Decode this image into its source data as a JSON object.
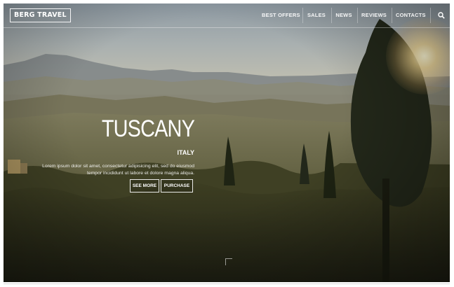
{
  "brand": {
    "logo_text": "BERG TRAVEL"
  },
  "nav": {
    "items": [
      {
        "label": "BEST OFFERS"
      },
      {
        "label": "SALES"
      },
      {
        "label": "NEWS"
      },
      {
        "label": "REVIEWS"
      },
      {
        "label": "CONTACTS"
      }
    ],
    "search_icon": "search-icon"
  },
  "hero": {
    "title": "TUSCANY",
    "subtitle": "ITALY",
    "description": "Lorem ipsum dolor sit amet, consectetur adipisicing elit, sed do eiusmod tempor incididunt ut labore et dolore magna aliqua.",
    "buttons": {
      "see_more": "SEE MORE",
      "purchase": "PURCHASE"
    }
  },
  "colors": {
    "text": "#ffffff",
    "border": "#ffffff"
  }
}
